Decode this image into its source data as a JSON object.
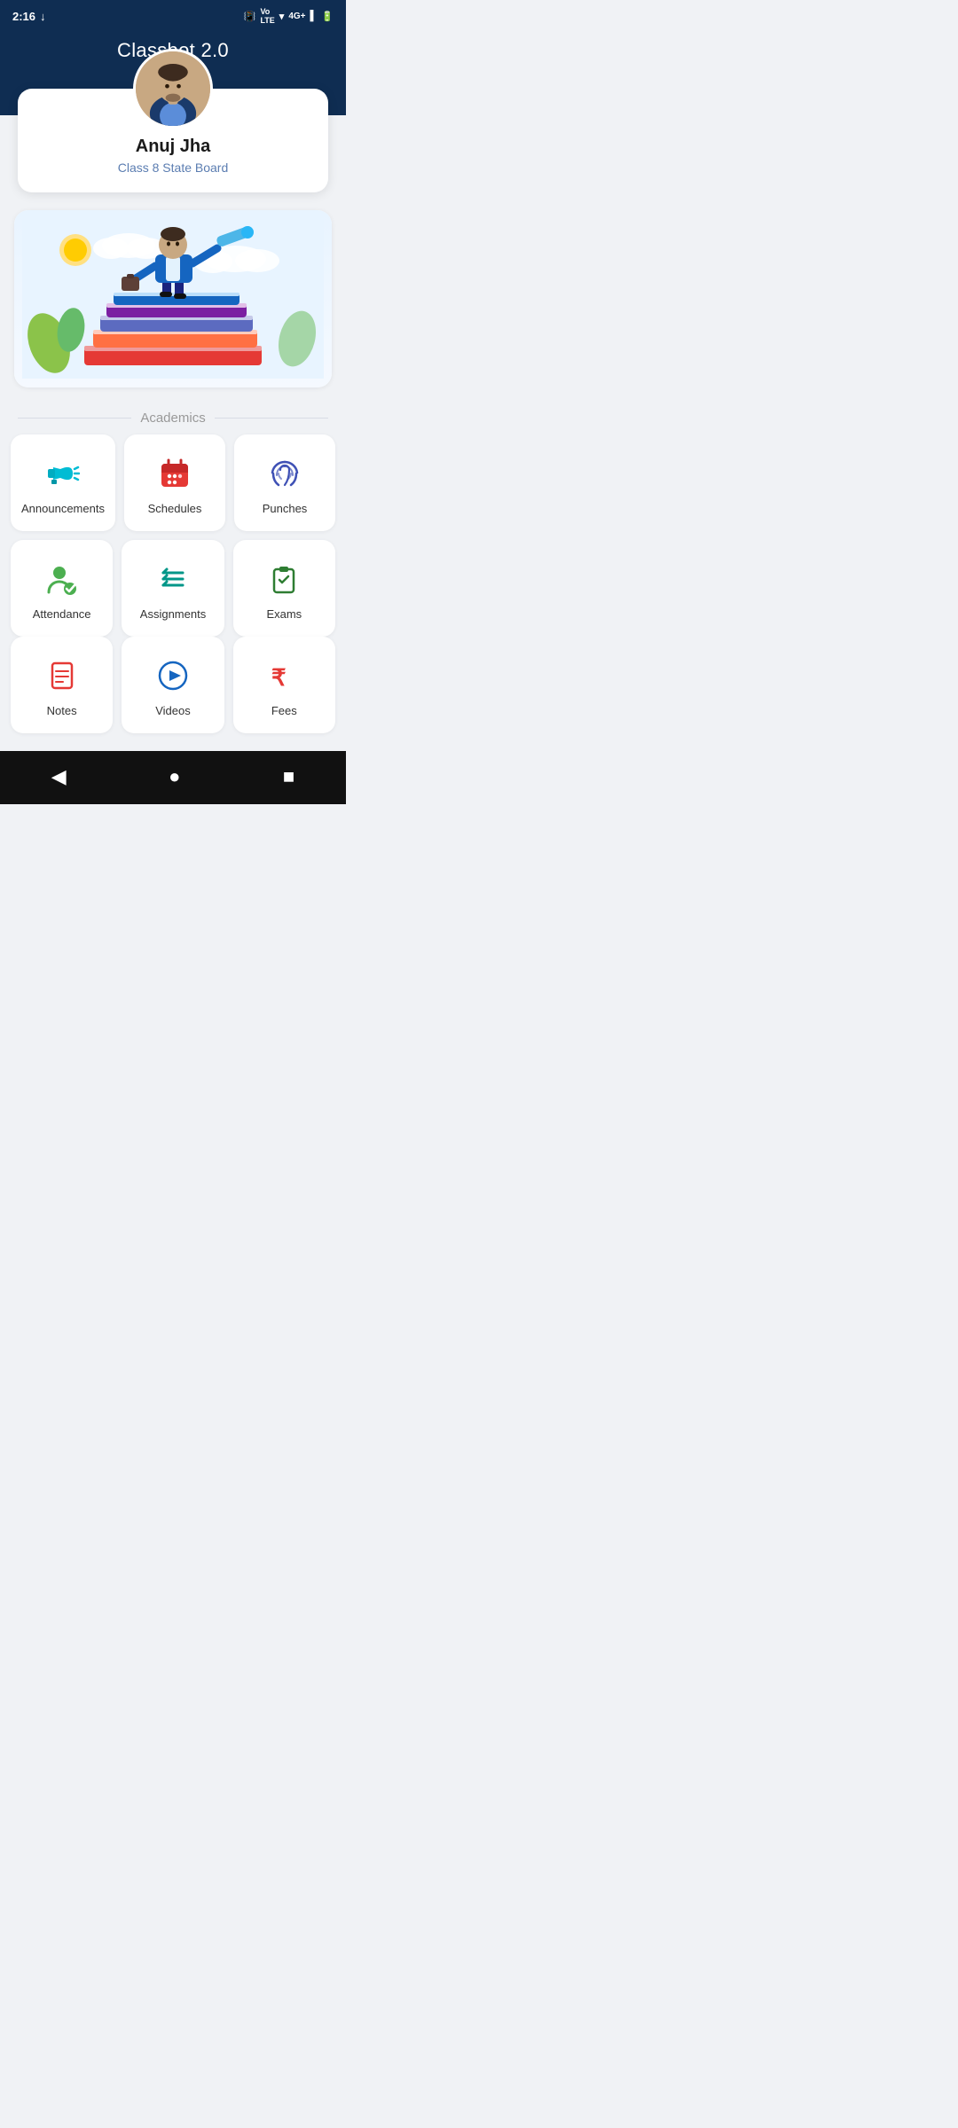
{
  "statusBar": {
    "time": "2:16",
    "downloadIcon": "↓"
  },
  "header": {
    "title": "Classbot 2.0"
  },
  "profile": {
    "name": "Anuj Jha",
    "class": "Class 8 State Board"
  },
  "sectionLabel": "Academics",
  "grid": {
    "row1": [
      {
        "id": "announcements",
        "label": "Announcements",
        "iconColor": "#00bcd4"
      },
      {
        "id": "schedules",
        "label": "Schedules",
        "iconColor": "#e53935"
      },
      {
        "id": "punches",
        "label": "Punches",
        "iconColor": "#3f51b5"
      }
    ],
    "row2": [
      {
        "id": "attendance",
        "label": "Attendance",
        "iconColor": "#4caf50"
      },
      {
        "id": "assignments",
        "label": "Assignments",
        "iconColor": "#009688"
      },
      {
        "id": "exams",
        "label": "Exams",
        "iconColor": "#2e7d32"
      }
    ],
    "row3": [
      {
        "id": "notes",
        "label": "Notes",
        "iconColor": "#e53935"
      },
      {
        "id": "videos",
        "label": "Videos",
        "iconColor": "#1565c0"
      },
      {
        "id": "fees",
        "label": "Fees",
        "iconColor": "#e53935"
      }
    ]
  },
  "navBar": {
    "back": "◀",
    "home": "●",
    "recent": "■"
  }
}
